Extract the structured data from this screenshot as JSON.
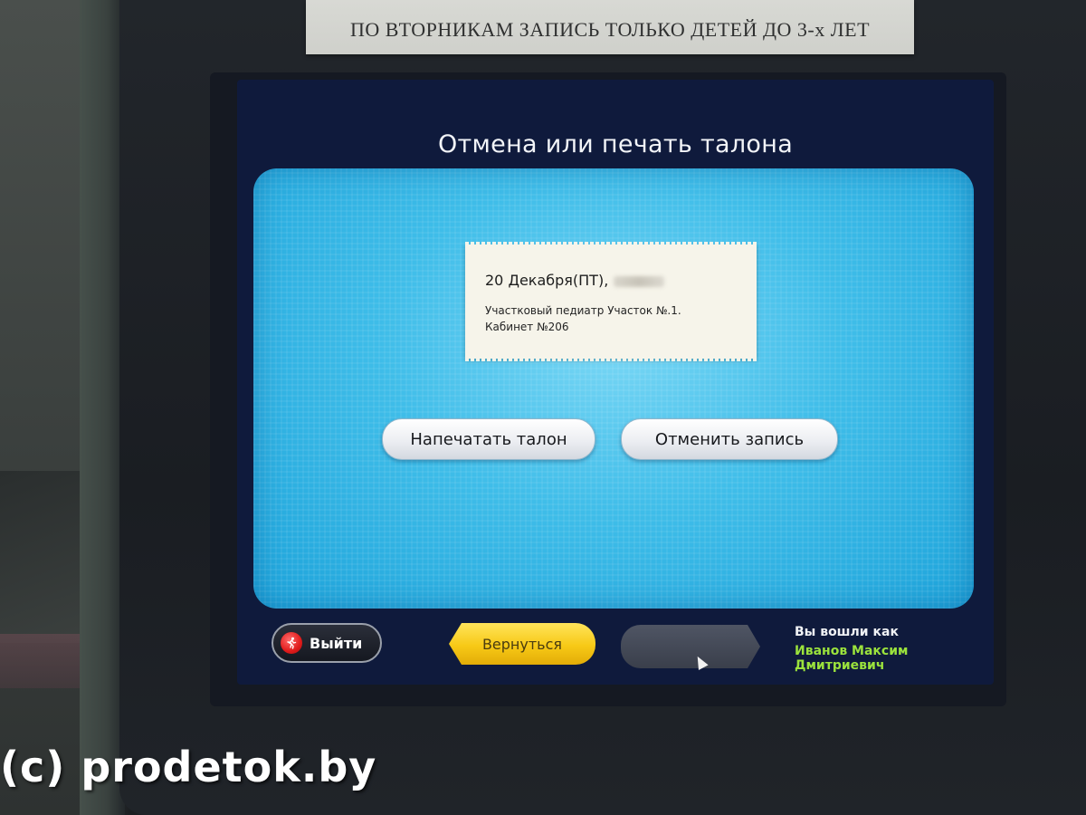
{
  "notice": {
    "text": "ПО ВТОРНИКАМ ЗАПИСЬ ТОЛЬКО ДЕТЕЙ ДО 3-х ЛЕТ"
  },
  "screen": {
    "title": "Отмена или печать талона",
    "ticket": {
      "date": "20 Декабря(ПТ),",
      "doctor": "Участковый педиатр Участок №.1.",
      "room": "Кабинет №206"
    },
    "actions": {
      "print_label": "Напечатать талон",
      "cancel_label": "Отменить запись"
    },
    "footer": {
      "exit_label": "Выйти",
      "back_label": "Вернуться",
      "logged_in_label": "Вы вошли как",
      "user_name": "Иванов Максим Дмитриевич"
    }
  },
  "watermark": "(c) prodetok.by",
  "colors": {
    "panel": "#3fbde9",
    "screen_bg": "#0f1a3c",
    "back_button": "#f7c916",
    "user_name": "#9be23c",
    "exit_icon": "#e01b1b"
  },
  "icons": {
    "exit": "running-man-exit-icon",
    "cursor": "mouse-pointer-icon"
  }
}
